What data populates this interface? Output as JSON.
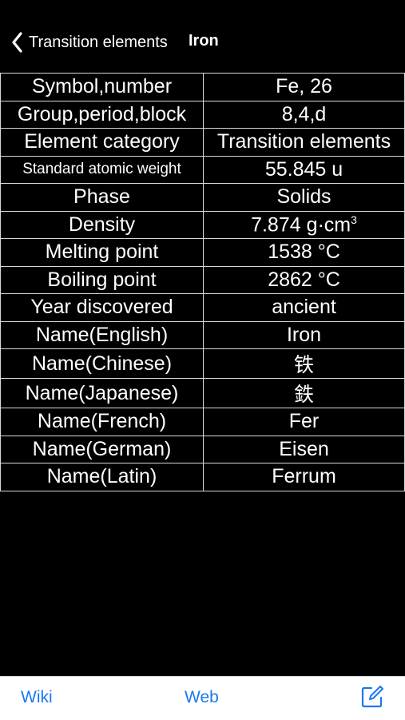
{
  "nav": {
    "back_label": "Transition elements",
    "title": "Iron"
  },
  "rows": [
    {
      "key": "Symbol,number",
      "value": "Fe, 26"
    },
    {
      "key": "Group,period,block",
      "value": "8,4,d"
    },
    {
      "key": "Element category",
      "value": "Transition elements"
    },
    {
      "key": "Standard atomic weight",
      "value": "55.845 u"
    },
    {
      "key": "Phase",
      "value": "Solids"
    },
    {
      "key": "Density",
      "value": "7.874 g·cm",
      "value_sup": "3"
    },
    {
      "key": "Melting point",
      "value": "1538 °C"
    },
    {
      "key": "Boiling point",
      "value": "2862 °C"
    },
    {
      "key": "Year discovered",
      "value": "ancient"
    },
    {
      "key": "Name(English)",
      "value": "Iron"
    },
    {
      "key": "Name(Chinese)",
      "value": "铁"
    },
    {
      "key": "Name(Japanese)",
      "value": "鉄"
    },
    {
      "key": "Name(French)",
      "value": "Fer"
    },
    {
      "key": "Name(German)",
      "value": "Eisen"
    },
    {
      "key": "Name(Latin)",
      "value": "Ferrum"
    }
  ],
  "toolbar": {
    "wiki_label": "Wiki",
    "web_label": "Web",
    "compose_icon": "compose-icon"
  },
  "colors": {
    "background": "#000000",
    "text": "#ffffff",
    "grid": "#d8d8d8",
    "accent": "#1a78f0",
    "toolbar_bg": "#ffffff"
  }
}
